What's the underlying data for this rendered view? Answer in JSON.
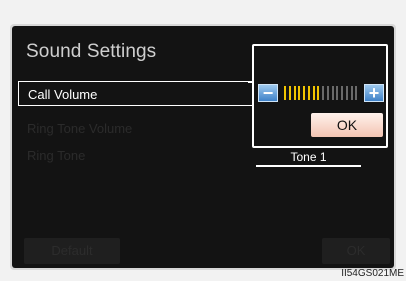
{
  "screen": {
    "title": "Sound Settings",
    "rows": [
      {
        "label": "Call Volume"
      },
      {
        "label": "Ring Tone Volume"
      },
      {
        "label": "Ring Tone"
      }
    ],
    "popup": {
      "minus_label": "−",
      "plus_label": "+",
      "ok_label": "OK",
      "volume_level": 0.5,
      "volume_total_steps": 16,
      "volume_active_color": "#f0c400",
      "volume_inactive_color": "#6a6a6a"
    },
    "ring_tone_value": "Tone 1",
    "footer": {
      "default_label": "Default",
      "ok_label": "OK"
    }
  },
  "image_code": "II54GS021ME",
  "colors": {
    "background": "#131313",
    "button_blue": "#3f82c8",
    "ok_popup": "#f3c4b2"
  }
}
